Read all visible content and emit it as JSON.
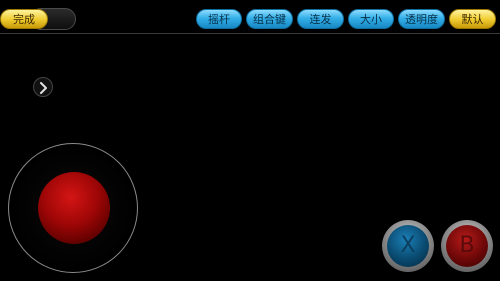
{
  "toolbar": {
    "done_label": "完成",
    "buttons": [
      {
        "label": "摇杆",
        "color": "#34b0e8"
      },
      {
        "label": "组合键",
        "color": "#34b0e8"
      },
      {
        "label": "连发",
        "color": "#34b0e8"
      },
      {
        "label": "大小",
        "color": "#34b0e8"
      },
      {
        "label": "透明度",
        "color": "#34b0e8"
      },
      {
        "label": "默认",
        "color": "#f2cf35"
      }
    ]
  },
  "sidebar_toggle": {
    "icon": "chevron-right-icon"
  },
  "joystick": {
    "knob_color": "#9e0606"
  },
  "action_buttons": [
    {
      "label": "X",
      "color": "#0a4a70"
    },
    {
      "label": "B",
      "color": "#6f0808"
    }
  ]
}
